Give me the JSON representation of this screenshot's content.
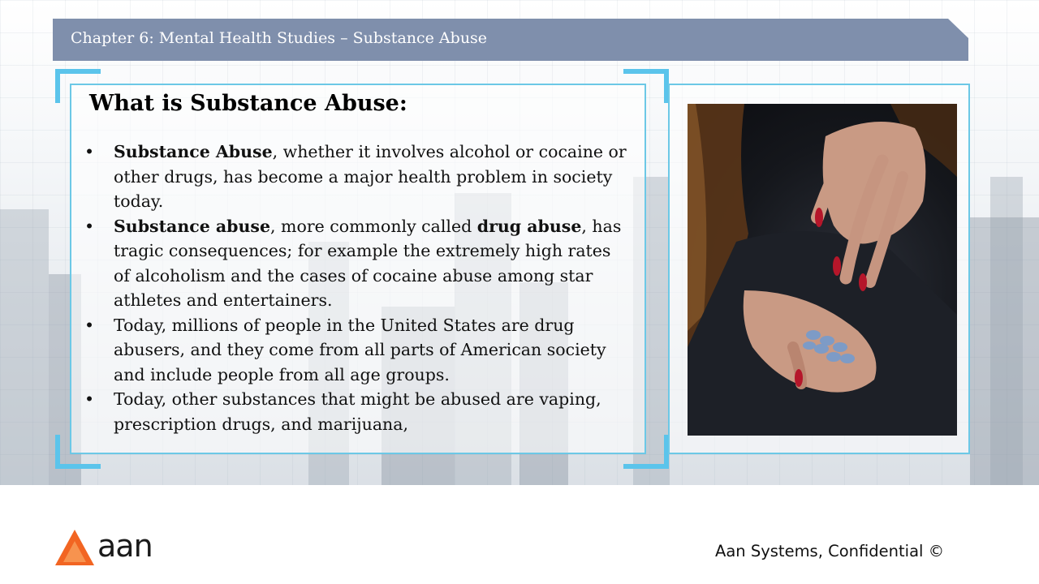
{
  "slide": {
    "title": "Chapter 6: Mental Health Studies – Substance Abuse",
    "heading": "What is Substance Abuse:",
    "bullet_symbol": "•",
    "bullets": [
      {
        "bold1": "Substance Abuse",
        "text1": ", whether it involves alcohol or cocaine or other drugs, has become a major health problem in society today.",
        "bold2": "",
        "text2": ""
      },
      {
        "bold1": "Substance abuse",
        "text1": ", more commonly called ",
        "bold2": "drug abuse",
        "text2": ", has tragic consequences; for example the extremely high rates of alcoholism and the cases of cocaine abuse among star athletes and entertainers."
      },
      {
        "bold1": "",
        "text1": "Today, millions of people in the United States are drug abusers, and they come from all parts of American society and include people from all age groups.",
        "bold2": "",
        "text2": ""
      },
      {
        "bold1": "",
        "text1": "Today, other substances that might be abused are vaping, prescription drugs, and marijuana,",
        "bold2": "",
        "text2": ""
      }
    ]
  },
  "footer": {
    "logo_text": "aan",
    "confidential": "Aan Systems, Confidential ©"
  },
  "colors": {
    "title_bar": "#7f8fac",
    "frame_accent": "#5bc4eb",
    "logo_orange": "#f26522"
  },
  "icons": {
    "photo": "hand-holding-pills-image",
    "logo": "orange-triangle-logo"
  }
}
